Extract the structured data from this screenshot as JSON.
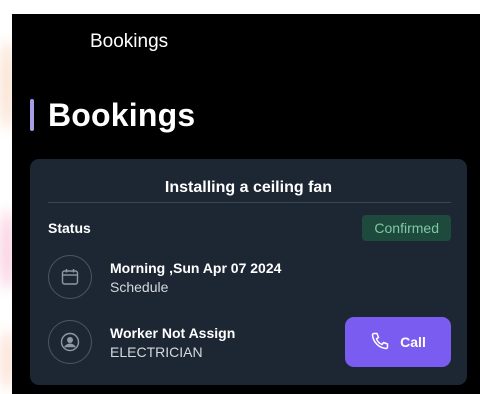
{
  "header": {
    "title": "Bookings"
  },
  "page": {
    "title": "Bookings",
    "accent_color": "#a89be8"
  },
  "booking": {
    "service_title": "Installing a ceiling fan",
    "status_label": "Status",
    "status_value": "Confirmed",
    "schedule": {
      "main": "Morning ,Sun Apr 07 2024",
      "sub": "Schedule",
      "icon": "calendar-icon"
    },
    "worker": {
      "main": "Worker Not Assign",
      "sub": "ELECTRICIAN",
      "icon": "user-avatar-icon"
    },
    "call_label": "Call",
    "call_icon": "phone-icon"
  },
  "colors": {
    "card_bg": "#1d2733",
    "call_button": "#7b5cf0",
    "status_badge_bg": "#1e4a3e",
    "status_badge_text": "#7fc8a3"
  }
}
